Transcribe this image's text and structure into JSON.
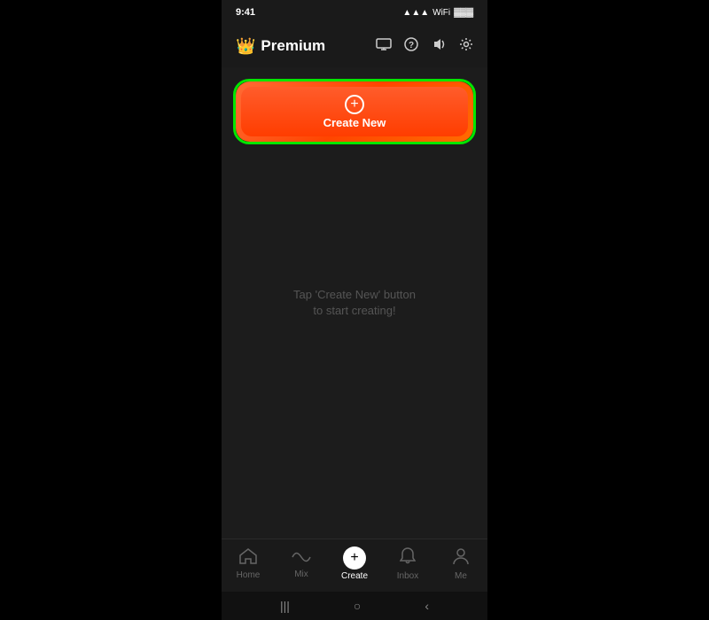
{
  "app": {
    "brand": "Premium",
    "crown_icon": "👑"
  },
  "status_bar": {
    "time": "9:41",
    "battery": "🔋",
    "signal": "📶"
  },
  "header": {
    "icons": {
      "monitor": "⬛",
      "help": "?",
      "audio": "🔊",
      "settings": "⚙"
    }
  },
  "create_section": {
    "button_label": "Create New",
    "empty_state_text": "Tap 'Create New' button to start creating!"
  },
  "bottom_nav": {
    "items": [
      {
        "id": "home",
        "label": "Home",
        "icon": "⌂",
        "active": false
      },
      {
        "id": "mix",
        "label": "Mix",
        "icon": "∞",
        "active": false
      },
      {
        "id": "create",
        "label": "Create",
        "icon": "+",
        "active": true
      },
      {
        "id": "inbox",
        "label": "Inbox",
        "icon": "🔔",
        "active": false
      },
      {
        "id": "me",
        "label": "Me",
        "icon": "👤",
        "active": false
      }
    ]
  },
  "system_nav": {
    "buttons": [
      "|||",
      "○",
      "<"
    ]
  }
}
